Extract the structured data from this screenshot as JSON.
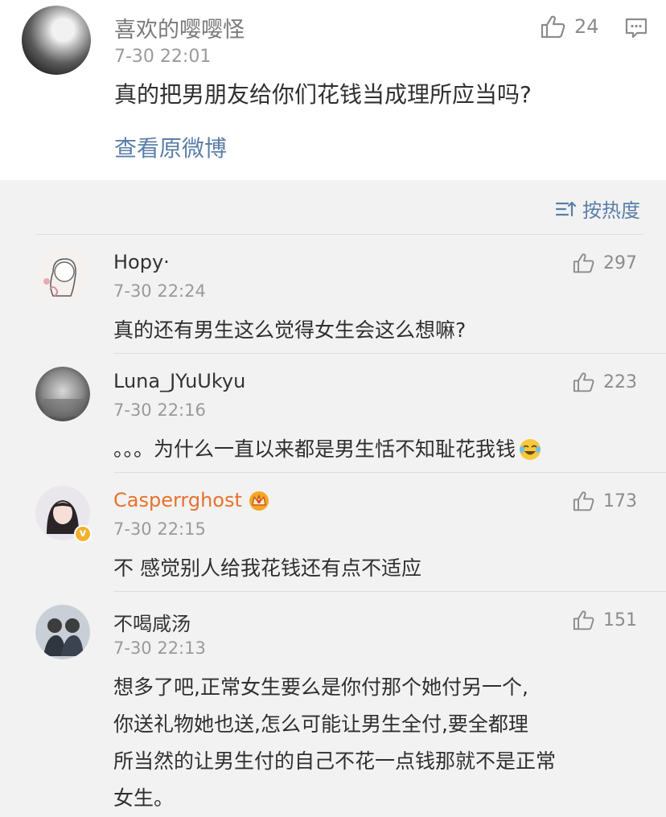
{
  "post": {
    "author": "喜欢的嘤嘤怪",
    "time": "7-30 22:01",
    "text": "真的把男朋友给你们花钱当成理所应当吗?",
    "view_original": "查看原微博",
    "likes": "24",
    "like_icon": "thumbs-up-icon",
    "comment_icon": "comment-icon"
  },
  "sort": {
    "label": "按热度",
    "icon": "sort-icon"
  },
  "comments": [
    {
      "name": "Hopy·",
      "time": "7-30 22:24",
      "likes": "297",
      "lines": [
        "真的还有男生这么觉得女生会这么想嘛?"
      ]
    },
    {
      "name": "Luna_JYuUkyu",
      "time": "7-30 22:16",
      "likes": "223",
      "lines": [
        "。。。为什么一直以来都是男生恬不知耻花我钱"
      ],
      "emoji": "laughing-crying-emoji"
    },
    {
      "name": "Casperrghost",
      "time": "7-30 22:15",
      "likes": "173",
      "lines": [
        "不 感觉别人给我花钱还有点不适应"
      ],
      "vip_icon": "crown-badge-icon",
      "verified": "verified-badge-icon"
    },
    {
      "name": "不喝咸汤",
      "time": "7-30 22:13",
      "likes": "151",
      "lines": [
        "想多了吧,正常女生要么是你付那个她付另一个,",
        "你送礼物她也送,怎么可能让男生全付,要全都理",
        "所当然的让男生付的自己不花一点钱那就不是正常",
        "女生。"
      ]
    }
  ],
  "colors": {
    "link": "#5b7ea8",
    "vip_name": "#e7722c",
    "background": "#f2f2f2"
  }
}
